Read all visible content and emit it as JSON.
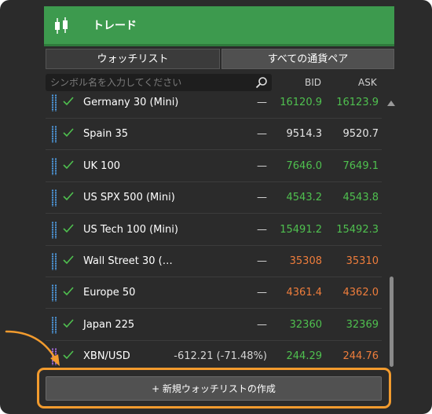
{
  "header": {
    "title": "トレード",
    "icon": "candlestick-icon"
  },
  "tabs": [
    {
      "label": "ウォッチリスト",
      "active": true
    },
    {
      "label": "すべての通貨ペア",
      "active": false
    }
  ],
  "search": {
    "placeholder": "シンボル名を入力してください",
    "value": ""
  },
  "columns": {
    "bid": "BID",
    "ask": "ASK"
  },
  "rows": [
    {
      "name": "Germany 30 (Mini)",
      "change": "—",
      "bid": "16120.9",
      "ask": "16123.9",
      "bid_color": "green",
      "ask_color": "green"
    },
    {
      "name": "Spain 35",
      "change": "—",
      "bid": "9514.3",
      "ask": "9520.7",
      "bid_color": "white",
      "ask_color": "white"
    },
    {
      "name": "UK 100",
      "change": "—",
      "bid": "7646.0",
      "ask": "7649.1",
      "bid_color": "green",
      "ask_color": "green"
    },
    {
      "name": "US SPX 500 (Mini)",
      "change": "—",
      "bid": "4543.2",
      "ask": "4543.8",
      "bid_color": "green",
      "ask_color": "green"
    },
    {
      "name": "US Tech 100 (Mini)",
      "change": "—",
      "bid": "15491.2",
      "ask": "15492.3",
      "bid_color": "green",
      "ask_color": "green"
    },
    {
      "name": "Wall Street 30 (…",
      "change": "—",
      "bid": "35308",
      "ask": "35310",
      "bid_color": "orange",
      "ask_color": "orange"
    },
    {
      "name": "Europe 50",
      "change": "—",
      "bid": "4361.4",
      "ask": "4362.0",
      "bid_color": "orange",
      "ask_color": "orange"
    },
    {
      "name": "Japan 225",
      "change": "—",
      "bid": "32360",
      "ask": "32369",
      "bid_color": "green",
      "ask_color": "green"
    },
    {
      "name": "XBN/USD",
      "change": "-612.21 (-71.48%)",
      "bid": "244.29",
      "ask": "244.76",
      "bid_color": "green",
      "ask_color": "orange"
    }
  ],
  "create_button": {
    "label": "+ 新規ウォッチリストの作成"
  },
  "colors": {
    "header_green": "#3d9a4e",
    "price_green": "#4fc04f",
    "price_orange": "#ee7d3c",
    "highlight": "#f29b2e"
  }
}
